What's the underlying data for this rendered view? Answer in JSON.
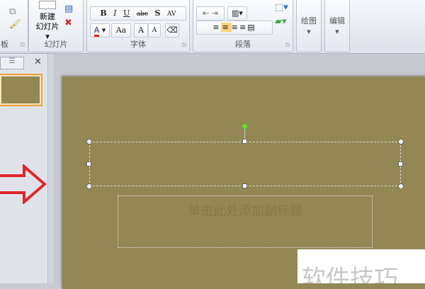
{
  "ribbon": {
    "clipboard": {
      "label": "板"
    },
    "slides": {
      "new_slide": "新建",
      "new_slide2": "幻灯片",
      "label": "幻灯片"
    },
    "font": {
      "label": "字体",
      "bold": "B",
      "italic": "I",
      "underline": "U",
      "strike": "abc",
      "shadow": "S",
      "spacing": "AV",
      "color": "A",
      "case": "Aa",
      "grow": "A",
      "shrink": "A"
    },
    "paragraph": {
      "label": "段落"
    },
    "drawing": {
      "label": "绘图"
    },
    "editing": {
      "label": "编辑"
    }
  },
  "panel": {
    "close": "✕",
    "outline_tab": "☰"
  },
  "slide": {
    "subtitle_placeholder": "单击此处添加副标题",
    "watermark": "软件技巧"
  },
  "colors": {
    "slide_bg": "#938753",
    "arrow": "#e0262a",
    "highlight": "#fbd27a"
  }
}
